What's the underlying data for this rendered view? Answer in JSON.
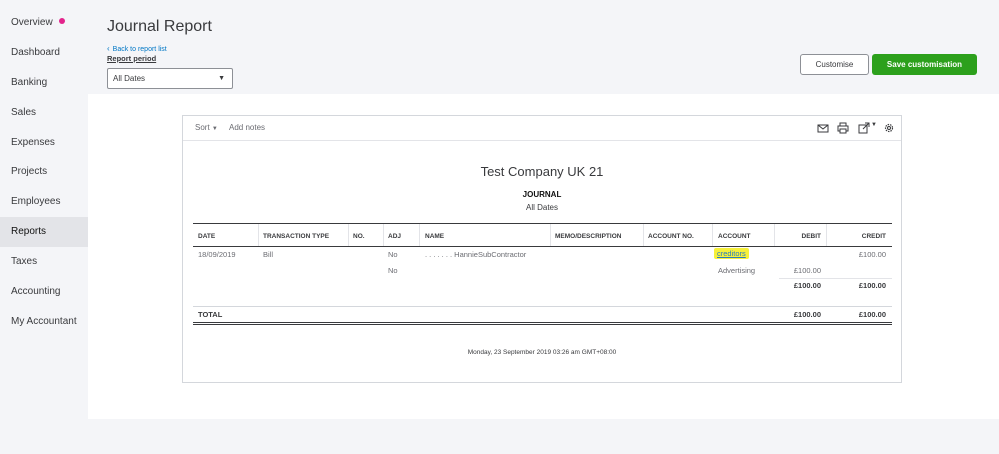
{
  "sidebar": {
    "items": [
      {
        "label": "Overview"
      },
      {
        "label": "Dashboard"
      },
      {
        "label": "Banking"
      },
      {
        "label": "Sales"
      },
      {
        "label": "Expenses"
      },
      {
        "label": "Projects"
      },
      {
        "label": "Employees"
      },
      {
        "label": "Reports"
      },
      {
        "label": "Taxes"
      },
      {
        "label": "Accounting"
      },
      {
        "label": "My Accountant"
      }
    ],
    "notification_color": "#e3248c"
  },
  "header": {
    "title": "Journal Report",
    "back_link": "Back to report list",
    "period_label": "Report period",
    "period_value": "All Dates",
    "customise_label": "Customise",
    "save_label": "Save customisation"
  },
  "toolbar": {
    "sort_label": "Sort",
    "add_notes_label": "Add notes",
    "icons": [
      "email-icon",
      "print-icon",
      "export-icon",
      "gear-icon"
    ]
  },
  "report": {
    "company": "Test Company UK 21",
    "title": "JOURNAL",
    "subtitle": "All Dates",
    "columns": [
      "DATE",
      "TRANSACTION TYPE",
      "NO.",
      "ADJ",
      "NAME",
      "MEMO/DESCRIPTION",
      "ACCOUNT NO.",
      "ACCOUNT",
      "DEBIT",
      "CREDIT"
    ],
    "rows": [
      {
        "date": "18/09/2019",
        "type": "Bill",
        "adj": "No",
        "name": ". . . . . . . HannieSubContractor",
        "account": "creditors",
        "debit": "",
        "credit": "£100.00"
      },
      {
        "date": "",
        "type": "",
        "adj": "No",
        "name": "",
        "account": "Advertising",
        "debit": "£100.00",
        "credit": ""
      }
    ],
    "subtotal": {
      "debit": "£100.00",
      "credit": "£100.00"
    },
    "total": {
      "label": "TOTAL",
      "debit": "£100.00",
      "credit": "£100.00"
    },
    "timestamp": "Monday, 23 September 2019  03:26 am GMT+08:00"
  },
  "colors": {
    "accent_green": "#2ca01c",
    "link_blue": "#0077c5",
    "highlight_yellow": "#f6f03a"
  }
}
